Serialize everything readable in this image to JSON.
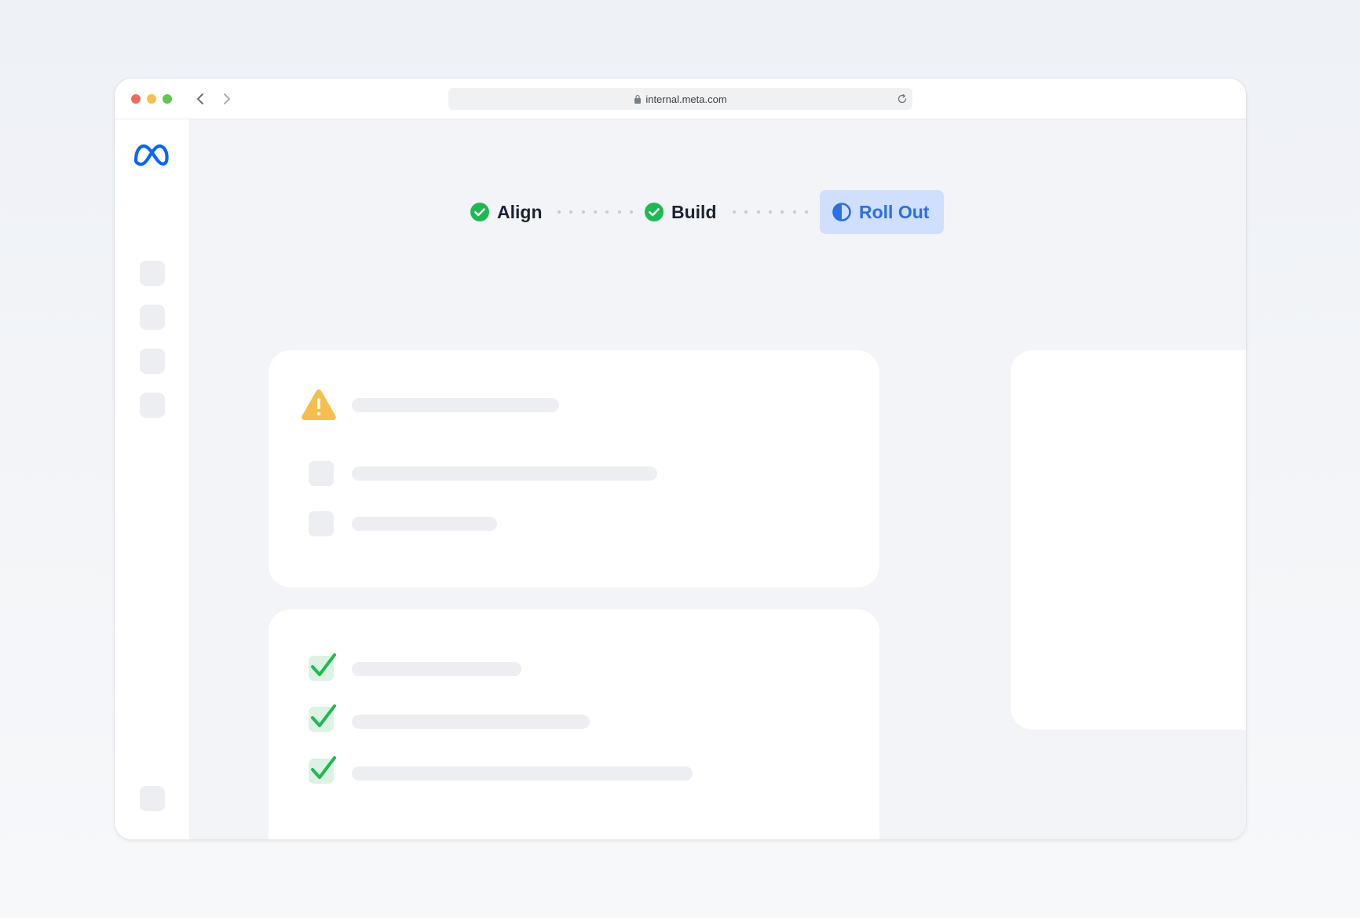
{
  "browser": {
    "url": "internal.meta.com",
    "traffic_lights": [
      "#ed6a5e",
      "#f5bf4f",
      "#61c554"
    ],
    "back_icon": "chevron-left-icon",
    "forward_icon": "chevron-right-icon",
    "lock_icon": "lock-icon",
    "reload_icon": "reload-icon"
  },
  "sidebar": {
    "logo": "meta-logo",
    "logo_color": "#0866ff",
    "item_count": 5
  },
  "stepper": {
    "steps": [
      {
        "label": "Align",
        "status": "complete"
      },
      {
        "label": "Build",
        "status": "complete"
      },
      {
        "label": "Roll Out",
        "status": "in-progress"
      }
    ],
    "colors": {
      "complete": "#1eb954",
      "active_text": "#2b6fe0",
      "active_bg": "#cfdffd"
    }
  },
  "cards": {
    "warning_card": {
      "icon": "warning-icon",
      "icon_color": "#f5bf4f"
    },
    "checklist_card": {
      "checked_items": 3,
      "check_color": "#1eb954"
    }
  }
}
